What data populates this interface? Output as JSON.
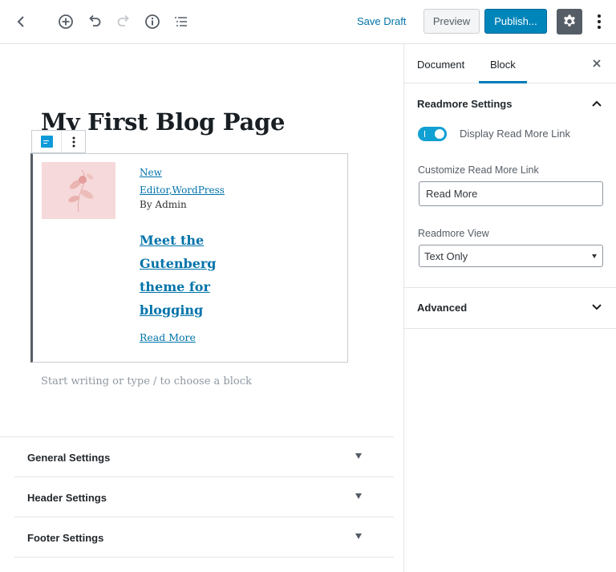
{
  "toolbar": {
    "back_icon": "chevron-left-icon",
    "add_icon": "plus-circle-icon",
    "undo_icon": "undo-icon",
    "redo_icon": "redo-icon",
    "info_icon": "info-icon",
    "outline_icon": "list-icon",
    "save_draft_label": "Save Draft",
    "preview_label": "Preview",
    "publish_label": "Publish...",
    "settings_icon": "gear-icon",
    "more_icon": "vertical-ellipsis-icon"
  },
  "editor": {
    "post_title": "My First Blog Page",
    "block": {
      "categories_line1": "New",
      "categories_line2": "Editor,WordPress",
      "author": "By Admin",
      "post_heading": "Meet the Gutenberg theme for blogging",
      "read_more": "Read More"
    },
    "appender_placeholder": "Start writing or type / to choose a block",
    "meta_boxes": [
      {
        "label": "General Settings"
      },
      {
        "label": "Header Settings"
      },
      {
        "label": "Footer Settings"
      }
    ]
  },
  "sidebar": {
    "tabs": [
      {
        "label": "Document"
      },
      {
        "label": "Block",
        "active": true
      }
    ],
    "panel_title": "Readmore Settings",
    "toggle_label": "Display Read More Link",
    "toggle_on": true,
    "customize_label": "Customize Read More Link",
    "customize_value": "Read More",
    "view_label": "Readmore View",
    "view_selected": "Text Only",
    "advanced_label": "Advanced"
  },
  "colors": {
    "accent": "#0085ba",
    "link": "#0073aa",
    "toggle": "#11a0d2"
  }
}
